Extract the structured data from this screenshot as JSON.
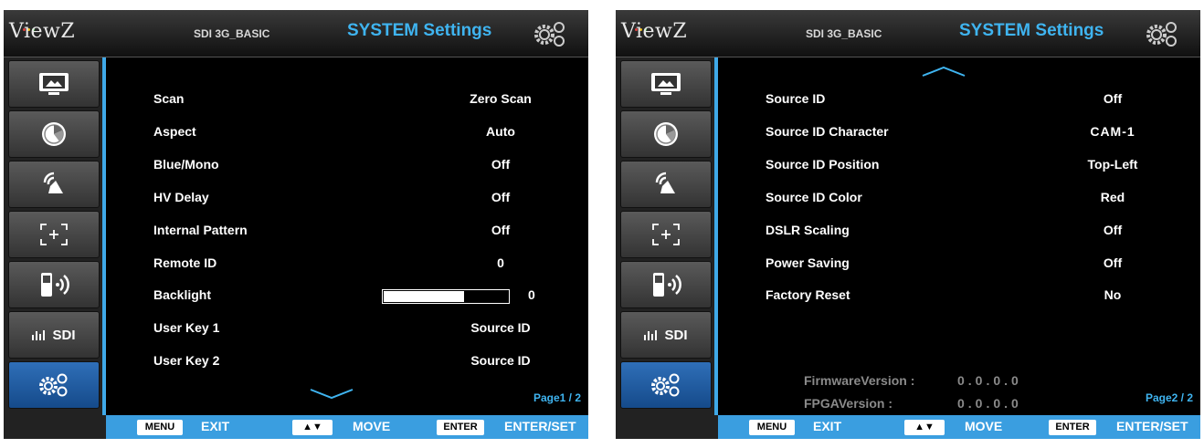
{
  "panels": [
    {
      "header": {
        "logo": "ViewZ",
        "model": "SDI 3G_BASIC",
        "title": "SYSTEM Settings"
      },
      "rows": [
        {
          "label": "Scan",
          "value": "Zero Scan"
        },
        {
          "label": "Aspect",
          "value": "Auto"
        },
        {
          "label": "Blue/Mono",
          "value": "Off"
        },
        {
          "label": "HV Delay",
          "value": "Off"
        },
        {
          "label": "Internal Pattern",
          "value": "Off"
        },
        {
          "label": "Remote ID",
          "value": "0"
        },
        {
          "label": "Backlight",
          "value": "0",
          "level_percent": 65
        },
        {
          "label": "User Key 1",
          "value": "Source ID"
        },
        {
          "label": "User Key 2",
          "value": "Source ID"
        }
      ],
      "page": "Page1 / 2",
      "sidebar": [
        "picture-icon",
        "color-icon",
        "audio-icon",
        "marker-icon",
        "remote-icon",
        "SDI",
        "settings-icon"
      ],
      "footer": {
        "menu_key": "MENU",
        "exit": "EXIT",
        "move": "MOVE",
        "enter_key": "ENTER",
        "enter_set": "ENTER/SET"
      }
    },
    {
      "header": {
        "logo": "ViewZ",
        "model": "SDI 3G_BASIC",
        "title": "SYSTEM Settings"
      },
      "rows": [
        {
          "label": "Source ID",
          "value": "Off"
        },
        {
          "label": "Source ID Character",
          "value": "CAM-1"
        },
        {
          "label": "Source ID Position",
          "value": "Top-Left"
        },
        {
          "label": "Source ID Color",
          "value": "Red"
        },
        {
          "label": "DSLR Scaling",
          "value": "Off"
        },
        {
          "label": "Power Saving",
          "value": "Off"
        },
        {
          "label": "Factory Reset",
          "value": "No"
        }
      ],
      "firmware": {
        "label": "FirmwareVersion :",
        "value": "0.0.0.0"
      },
      "fpga": {
        "label": "FPGAVersion :",
        "value": "0.0.0.0"
      },
      "page": "Page2 / 2",
      "sidebar": [
        "picture-icon",
        "color-icon",
        "audio-icon",
        "marker-icon",
        "remote-icon",
        "SDI",
        "settings-icon"
      ],
      "footer": {
        "menu_key": "MENU",
        "exit": "EXIT",
        "move": "MOVE",
        "enter_key": "ENTER",
        "enter_set": "ENTER/SET"
      }
    }
  ],
  "colors": {
    "accent": "#3fb4f0",
    "footer": "#3a9ee0",
    "active_tab": "#2f6fb8"
  }
}
